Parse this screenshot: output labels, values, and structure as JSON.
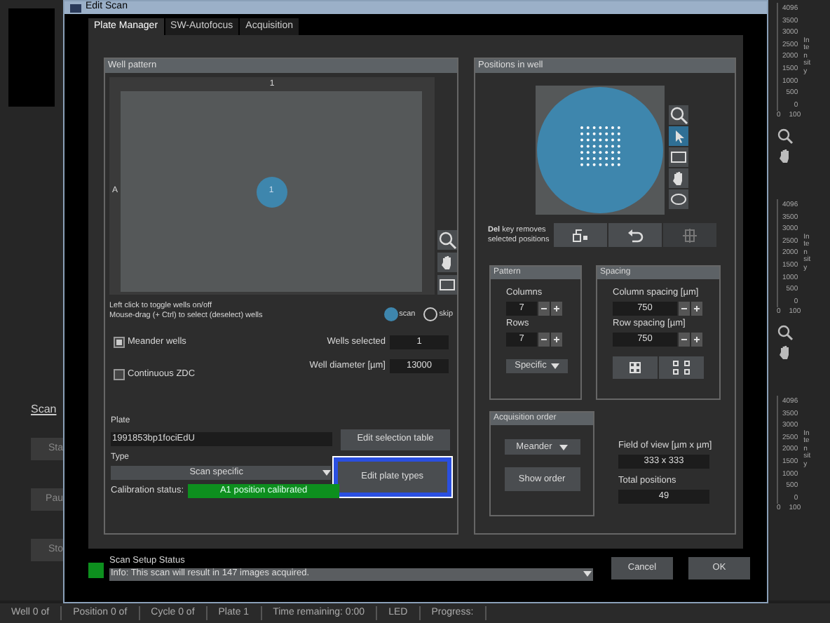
{
  "background": {
    "left_tab": "Scan",
    "left_buttons": [
      "Sta",
      "Pau",
      "Sto"
    ],
    "scales": [
      {
        "ticks": [
          "4096",
          "3500",
          "3000",
          "2500",
          "2000",
          "1500",
          "1000",
          "500",
          "0"
        ],
        "label": "Intensity",
        "range": [
          "0",
          "100"
        ]
      },
      {
        "ticks": [
          "4096",
          "3500",
          "3000",
          "2500",
          "2000",
          "1500",
          "1000",
          "500",
          "0"
        ],
        "label": "Intensity",
        "range": [
          "0",
          "100"
        ]
      },
      {
        "ticks": [
          "4096",
          "3500",
          "3000",
          "2500",
          "2000",
          "1500",
          "1000",
          "500",
          "0"
        ],
        "label": "Intensity",
        "range": [
          "0",
          "100"
        ]
      }
    ],
    "status_bar": [
      "Well 0 of",
      "Position 0 of",
      "Cycle 0 of",
      "Plate 1",
      "Time remaining: 0:00",
      "LED",
      "Progress:"
    ]
  },
  "dialog": {
    "title": "Edit Scan",
    "tabs": [
      {
        "label": "Plate Manager",
        "selected": true
      },
      {
        "label": "SW-Autofocus",
        "selected": false
      },
      {
        "label": "Acquisition",
        "selected": false
      }
    ],
    "well_pattern": {
      "title": "Well pattern",
      "column_header": "1",
      "row_header": "A",
      "wells": [
        {
          "label": "1",
          "scan": true
        }
      ],
      "hint": "Left click to toggle wells on/off\nMouse-drag (+ Ctrl) to select (deselect) wells",
      "legend": [
        {
          "label": "scan",
          "kind": "scan"
        },
        {
          "label": "skip",
          "kind": "skip"
        }
      ],
      "checkboxes": [
        {
          "label": "Meander wells",
          "checked": true
        },
        {
          "label": "Continuous ZDC",
          "checked": false
        }
      ],
      "fields": [
        {
          "label": "Wells selected",
          "value": "1"
        },
        {
          "label": "Well diameter [µm]",
          "value": "13000"
        }
      ],
      "plate_label": "Plate",
      "plate": "1991853bp1fociEdU",
      "edit_selection": "Edit selection table",
      "type_label": "Type",
      "type": "Scan specific",
      "edit_types": "Edit plate types",
      "calibration_label": "Calibration status:",
      "calibration": "A1 position calibrated"
    },
    "positions": {
      "title": "Positions in well",
      "tools": [
        {
          "kind": "zoom",
          "selected": false
        },
        {
          "kind": "pointer",
          "selected": true
        },
        {
          "kind": "rect",
          "selected": false
        },
        {
          "kind": "hand",
          "selected": false
        },
        {
          "kind": "ellipse",
          "selected": false
        }
      ],
      "del_hint": "**Del** key removes selected positions",
      "pattern": {
        "title": "Pattern",
        "columns_label": "Columns",
        "columns": "7",
        "rows_label": "Rows",
        "rows": "7",
        "mode": "Specific"
      },
      "spacing": {
        "title": "Spacing",
        "column_label": "Column spacing [µm]",
        "column": "750",
        "row_label": "Row spacing [µm]",
        "row": "750"
      },
      "order": {
        "title": "Acquisition order",
        "mode": "Meander",
        "show": "Show order"
      },
      "fov_label": "Field of view [µm x µm]",
      "fov": "333 x 333",
      "total_label": "Total positions",
      "total": "49"
    },
    "status": {
      "title": "Scan Setup Status",
      "message": "Info: This scan will result in 147 images acquired."
    },
    "buttons": [
      "Cancel",
      "OK"
    ]
  }
}
